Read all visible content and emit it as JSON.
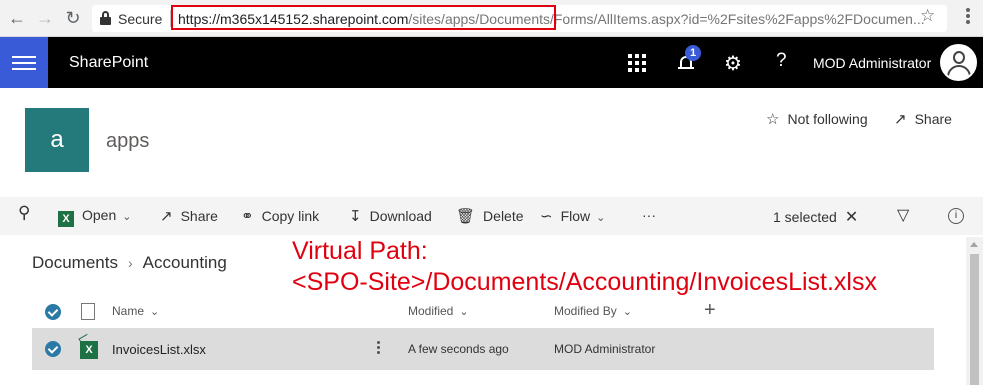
{
  "browser": {
    "secure_label": "Secure",
    "url_host": "https://m365x145152.sharepoint.com",
    "url_path": "/sites/apps/Documents/Forms/AllItems.aspx?id=%2Fsites%2Fapps%2FDocumen..."
  },
  "suite": {
    "app_name": "SharePoint",
    "notification_count": "1",
    "help_label": "?",
    "user_name": "MOD Administrator"
  },
  "site": {
    "logo_letter": "a",
    "title": "apps",
    "follow_label": "Not following",
    "share_label": "Share"
  },
  "command_bar": {
    "open": "Open",
    "share": "Share",
    "copy_link": "Copy link",
    "download": "Download",
    "delete": "Delete",
    "flow": "Flow",
    "more": "···",
    "selected": "1 selected"
  },
  "breadcrumb": {
    "items": [
      "Documents",
      "Accounting"
    ]
  },
  "annotation": {
    "line1": "Virtual Path:",
    "line2": "<SPO-Site>/Documents/Accounting/InvoicesList.xlsx"
  },
  "list": {
    "columns": {
      "name": "Name",
      "modified": "Modified",
      "modified_by": "Modified By"
    },
    "rows": [
      {
        "name": "InvoicesList.xlsx",
        "modified": "A few seconds ago",
        "modified_by": "MOD Administrator"
      }
    ]
  },
  "colors": {
    "suite_bar": "#000000",
    "waffle": "#3a5bd8",
    "site_logo": "#247a7b",
    "annotation": "#e0000f",
    "excel": "#1e7145",
    "check": "#2b79a6"
  },
  "icons": [
    "back-icon",
    "forward-icon",
    "reload-icon",
    "lock-icon",
    "star-icon",
    "kebab-menu-icon",
    "waffle-icon",
    "app-launcher-icon",
    "bell-icon",
    "gear-icon",
    "help-icon",
    "user-avatar-icon",
    "follow-star-icon",
    "share-icon",
    "search-icon",
    "excel-icon",
    "copy-link-icon",
    "download-icon",
    "delete-icon",
    "flow-icon",
    "close-icon",
    "filter-icon",
    "info-icon",
    "check-icon",
    "document-icon",
    "add-column-icon"
  ]
}
